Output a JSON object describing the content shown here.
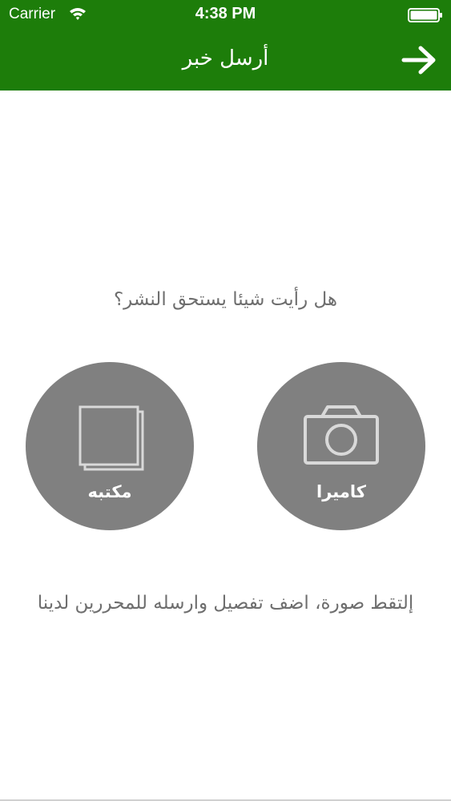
{
  "status_bar": {
    "carrier": "Carrier",
    "time": "4:38 PM",
    "wifi_icon": "wifi-icon",
    "battery_icon": "battery-icon"
  },
  "nav_bar": {
    "title": "أرسل خبر",
    "forward_icon": "arrow-right-icon",
    "background_color": "#1d7d0a"
  },
  "prompt": "هل رأيت شيئا يستحق النشر؟",
  "buttons": {
    "library": {
      "label": "مكتبه",
      "icon": "photo-library-icon"
    },
    "camera": {
      "label": "كاميرا",
      "icon": "camera-icon"
    },
    "button_color": "#808080"
  },
  "instructions": "إلتقط صورة، اضف تفصيل وارسله للمحررين لدينا"
}
